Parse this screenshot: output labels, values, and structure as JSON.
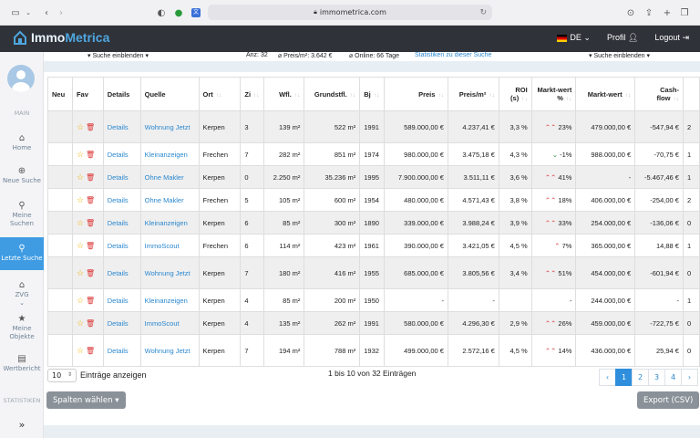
{
  "browser": {
    "url": "immometrica.com"
  },
  "app": {
    "logo_a": "Immo",
    "logo_b": "Metrica",
    "lang": "DE",
    "profile": "Profil",
    "logout": "Logout"
  },
  "sidebar": {
    "section_main": "MAIN",
    "section_stats": "STATISTIKEN",
    "items": [
      {
        "label": "Home",
        "icon": "home-icon",
        "glyph": "⌂"
      },
      {
        "label": "Neue Suche",
        "icon": "search-plus-icon",
        "glyph": "⊕"
      },
      {
        "label": "Meine Suchen",
        "icon": "search-icon",
        "glyph": "⚲"
      },
      {
        "label": "Letzte Suche",
        "icon": "search-icon",
        "glyph": "⚲"
      },
      {
        "label": "ZVG",
        "icon": "bank-icon",
        "glyph": "⌂"
      },
      {
        "label": "Meine Objekte",
        "icon": "star-icon",
        "glyph": "★"
      },
      {
        "label": "Wertbericht",
        "icon": "report-icon",
        "glyph": "▤"
      }
    ]
  },
  "stats": {
    "search_toggle_left": "▾ Suche einblenden ▾",
    "count": "Anz: 32",
    "price_sqm": "⌀ Preis/m²: 3.642 €",
    "online": "⌀ Online: 66 Tage",
    "stats_link": "Statistiken zu dieser Suche",
    "search_toggle_right": "▾ Suche einblenden ▾"
  },
  "table": {
    "headers": [
      "Neu",
      "Fav",
      "Details",
      "Quelle",
      "Ort",
      "Zi",
      "Wfl.",
      "Grundstfl.",
      "Bj",
      "Preis",
      "Preis/m²",
      "ROI (s)",
      "Markt-wert %",
      "Markt-wert",
      "Cash-flow",
      ""
    ],
    "rows": [
      {
        "details": "Details",
        "quelle": "Wohnung Jetzt",
        "ort": "Kerpen",
        "zi": "3",
        "wfl": "139 m²",
        "gfl": "522 m²",
        "bj": "1991",
        "preis": "589.000,00 €",
        "psqm": "4.237,41 €",
        "roi": "3,3 %",
        "mw_pct": "23%",
        "mw_dir": "up",
        "mw": "479.000,00 €",
        "cf": "-547,94 €",
        "x": "2"
      },
      {
        "details": "Details",
        "quelle": "Kleinanzeigen",
        "ort": "Frechen",
        "zi": "7",
        "wfl": "282 m²",
        "gfl": "851 m²",
        "bj": "1974",
        "preis": "980.000,00 €",
        "psqm": "3.475,18 €",
        "roi": "4,3 %",
        "mw_pct": "-1%",
        "mw_dir": "down",
        "mw": "988.000,00 €",
        "cf": "-70,75 €",
        "x": "1"
      },
      {
        "details": "Details",
        "quelle": "Ohne Makler",
        "ort": "Kerpen",
        "zi": "0",
        "wfl": "2.250 m²",
        "gfl": "35.236 m²",
        "bj": "1995",
        "preis": "7.900.000,00 €",
        "psqm": "3.511,11 €",
        "roi": "3,6 %",
        "mw_pct": "41%",
        "mw_dir": "up",
        "mw": "-",
        "cf": "-5.467,46 €",
        "x": "1"
      },
      {
        "details": "Details",
        "quelle": "Ohne Makler",
        "ort": "Frechen",
        "zi": "5",
        "wfl": "105 m²",
        "gfl": "600 m²",
        "bj": "1954",
        "preis": "480.000,00 €",
        "psqm": "4.571,43 €",
        "roi": "3,8 %",
        "mw_pct": "18%",
        "mw_dir": "up",
        "mw": "406.000,00 €",
        "cf": "-254,00 €",
        "x": "2"
      },
      {
        "details": "Details",
        "quelle": "Kleinanzeigen",
        "ort": "Kerpen",
        "zi": "6",
        "wfl": "85 m²",
        "gfl": "300 m²",
        "bj": "1890",
        "preis": "339.000,00 €",
        "psqm": "3.988,24 €",
        "roi": "3,9 %",
        "mw_pct": "33%",
        "mw_dir": "up",
        "mw": "254.000,00 €",
        "cf": "-136,06 €",
        "x": "0"
      },
      {
        "details": "Details",
        "quelle": "ImmoScout",
        "ort": "Frechen",
        "zi": "6",
        "wfl": "114 m²",
        "gfl": "423 m²",
        "bj": "1961",
        "preis": "390.000,00 €",
        "psqm": "3.421,05 €",
        "roi": "4,5 %",
        "mw_pct": "7%",
        "mw_dir": "up1",
        "mw": "365.000,00 €",
        "cf": "14,88 €",
        "x": "1"
      },
      {
        "details": "Details",
        "quelle": "Wohnung Jetzt",
        "ort": "Kerpen",
        "zi": "7",
        "wfl": "180 m²",
        "gfl": "416 m²",
        "bj": "1955",
        "preis": "685.000,00 €",
        "psqm": "3.805,56 €",
        "roi": "3,4 %",
        "mw_pct": "51%",
        "mw_dir": "up",
        "mw": "454.000,00 €",
        "cf": "-601,94 €",
        "x": "0"
      },
      {
        "details": "Details",
        "quelle": "Kleinanzeigen",
        "ort": "Kerpen",
        "zi": "4",
        "wfl": "85 m²",
        "gfl": "200 m²",
        "bj": "1950",
        "preis": "-",
        "psqm": "-",
        "roi": "",
        "mw_pct": "-",
        "mw_dir": "none",
        "mw": "244.000,00 €",
        "cf": "-",
        "x": "1"
      },
      {
        "details": "Details",
        "quelle": "ImmoScout",
        "ort": "Kerpen",
        "zi": "4",
        "wfl": "135 m²",
        "gfl": "262 m²",
        "bj": "1991",
        "preis": "580.000,00 €",
        "psqm": "4.296,30 €",
        "roi": "2,9 %",
        "mw_pct": "26%",
        "mw_dir": "up",
        "mw": "459.000,00 €",
        "cf": "-722,75 €",
        "x": "0"
      },
      {
        "details": "Details",
        "quelle": "Wohnung Jetzt",
        "ort": "Kerpen",
        "zi": "7",
        "wfl": "194 m²",
        "gfl": "788 m²",
        "bj": "1932",
        "preis": "499.000,00 €",
        "psqm": "2.572,16 €",
        "roi": "4,5 %",
        "mw_pct": "14%",
        "mw_dir": "up",
        "mw": "436.000,00 €",
        "cf": "25,94 €",
        "x": "0"
      }
    ]
  },
  "footer": {
    "page_size": "10",
    "entries_label": "Einträge anzeigen",
    "summary": "1 bis 10 von 32 Einträgen",
    "pages": [
      "‹",
      "1",
      "2",
      "3",
      "4",
      "›"
    ],
    "columns_btn": "Spalten wählen ▾",
    "export_btn": "Export (CSV)"
  }
}
